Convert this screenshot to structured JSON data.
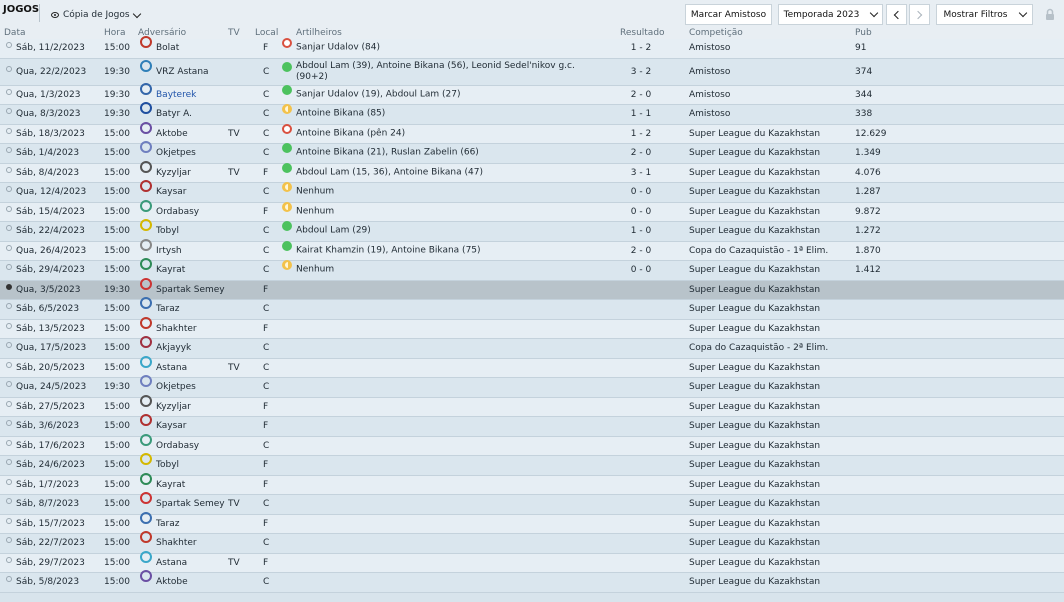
{
  "toolbar": {
    "title": "JOGOS",
    "view_label": "Cópia de Jogos",
    "friendly_button": "Marcar Amistoso",
    "season_select": "Temporada 2023",
    "filters_button": "Mostrar Filtros"
  },
  "columns": {
    "date": "Data",
    "time": "Hora",
    "opponent": "Adversário",
    "tv": "TV",
    "venue": "Local",
    "scorers": "Artilheiros",
    "result": "Resultado",
    "competition": "Competição",
    "attendance": "Pub"
  },
  "colors": {
    "win": "#4cc25e",
    "draw": "#f3c24b",
    "loss": "#d9503f",
    "selected_row": "#b8c3ca"
  },
  "matches": [
    {
      "date": "Sáb, 11/2/2023",
      "time": "15:00",
      "opponent": "Bolat",
      "crest_color": "#c0392b",
      "tv": "",
      "venue": "F",
      "status": "loss",
      "scorers": "Sanjar Udalov (84)",
      "result": "1 - 2",
      "competition": "Amistoso",
      "attendance": "91"
    },
    {
      "date": "Qua, 22/2/2023",
      "time": "19:30",
      "opponent": "VRZ Astana",
      "crest_color": "#2f7fb8",
      "tv": "",
      "venue": "C",
      "status": "win",
      "scorers": "Abdoul Lam (39), Antoine Bikana (56), Leonid Sedel'nikov g.c. (90+2)",
      "result": "3 - 2",
      "competition": "Amistoso",
      "attendance": "374"
    },
    {
      "date": "Qua, 1/3/2023",
      "time": "19:30",
      "opponent": "Bayterek",
      "crest_color": "#3366aa",
      "tv": "",
      "venue": "C",
      "status": "win",
      "scorers": "Sanjar Udalov (19), Abdoul Lam (27)",
      "result": "2 - 0",
      "competition": "Amistoso",
      "attendance": "344"
    },
    {
      "date": "Qua, 8/3/2023",
      "time": "19:30",
      "opponent": "Batyr A.",
      "crest_color": "#1f4fa0",
      "tv": "",
      "venue": "C",
      "status": "draw",
      "scorers": "Antoine Bikana (85)",
      "result": "1 - 1",
      "competition": "Amistoso",
      "attendance": "338"
    },
    {
      "date": "Sáb, 18/3/2023",
      "time": "15:00",
      "opponent": "Aktobe",
      "crest_color": "#6a4fa3",
      "tv": "TV",
      "venue": "C",
      "status": "loss",
      "scorers": "Antoine Bikana (pên 24)",
      "result": "1 - 2",
      "competition": "Super League du Kazakhstan",
      "attendance": "12.629"
    },
    {
      "date": "Sáb, 1/4/2023",
      "time": "15:00",
      "opponent": "Okjetpes",
      "crest_color": "#6f7fbf",
      "tv": "",
      "venue": "C",
      "status": "win",
      "scorers": "Antoine Bikana (21), Ruslan Zabelin (66)",
      "result": "2 - 0",
      "competition": "Super League du Kazakhstan",
      "attendance": "1.349"
    },
    {
      "date": "Sáb, 8/4/2023",
      "time": "15:00",
      "opponent": "Kyzyljar",
      "crest_color": "#555555",
      "tv": "TV",
      "venue": "F",
      "status": "win",
      "scorers": "Abdoul Lam (15, 36), Antoine Bikana (47)",
      "result": "3 - 1",
      "competition": "Super League du Kazakhstan",
      "attendance": "4.076"
    },
    {
      "date": "Qua, 12/4/2023",
      "time": "15:00",
      "opponent": "Kaysar",
      "crest_color": "#b03030",
      "tv": "",
      "venue": "C",
      "status": "draw",
      "scorers": "Nenhum",
      "result": "0 - 0",
      "competition": "Super League du Kazakhstan",
      "attendance": "1.287"
    },
    {
      "date": "Sáb, 15/4/2023",
      "time": "15:00",
      "opponent": "Ordabasy",
      "crest_color": "#3a9a7a",
      "tv": "",
      "venue": "F",
      "status": "draw",
      "scorers": "Nenhum",
      "result": "0 - 0",
      "competition": "Super League du Kazakhstan",
      "attendance": "9.872"
    },
    {
      "date": "Sáb, 22/4/2023",
      "time": "15:00",
      "opponent": "Tobyl",
      "crest_color": "#d4b800",
      "tv": "",
      "venue": "C",
      "status": "win",
      "scorers": "Abdoul Lam (29)",
      "result": "1 - 0",
      "competition": "Super League du Kazakhstan",
      "attendance": "1.272"
    },
    {
      "date": "Qua, 26/4/2023",
      "time": "15:00",
      "opponent": "Irtysh",
      "crest_color": "#888888",
      "tv": "",
      "venue": "C",
      "status": "win",
      "scorers": "Kairat Khamzin (19), Antoine Bikana (75)",
      "result": "2 - 0",
      "competition": "Copa do Cazaquistão - 1ª Elim.",
      "attendance": "1.870"
    },
    {
      "date": "Sáb, 29/4/2023",
      "time": "15:00",
      "opponent": "Kayrat",
      "crest_color": "#2e8b57",
      "tv": "",
      "venue": "C",
      "status": "draw",
      "scorers": "Nenhum",
      "result": "0 - 0",
      "competition": "Super League du Kazakhstan",
      "attendance": "1.412"
    },
    {
      "date": "Qua, 3/5/2023",
      "time": "19:30",
      "opponent": "Spartak Semey",
      "crest_color": "#cc3333",
      "tv": "",
      "venue": "F",
      "status": "",
      "scorers": "",
      "result": "",
      "competition": "Super League du Kazakhstan",
      "attendance": "",
      "selected": true
    },
    {
      "date": "Sáb, 6/5/2023",
      "time": "15:00",
      "opponent": "Taraz",
      "crest_color": "#3c6fb0",
      "tv": "",
      "venue": "C",
      "status": "",
      "scorers": "",
      "result": "",
      "competition": "Super League du Kazakhstan",
      "attendance": ""
    },
    {
      "date": "Sáb, 13/5/2023",
      "time": "15:00",
      "opponent": "Shakhter",
      "crest_color": "#c0392b",
      "tv": "",
      "venue": "F",
      "status": "",
      "scorers": "",
      "result": "",
      "competition": "Super League du Kazakhstan",
      "attendance": ""
    },
    {
      "date": "Qua, 17/5/2023",
      "time": "15:00",
      "opponent": "Akjayyk",
      "crest_color": "#a03040",
      "tv": "",
      "venue": "C",
      "status": "",
      "scorers": "",
      "result": "",
      "competition": "Copa do Cazaquistão - 2ª Elim.",
      "attendance": ""
    },
    {
      "date": "Sáb, 20/5/2023",
      "time": "15:00",
      "opponent": "Astana",
      "crest_color": "#3aa7c9",
      "tv": "TV",
      "venue": "C",
      "status": "",
      "scorers": "",
      "result": "",
      "competition": "Super League du Kazakhstan",
      "attendance": ""
    },
    {
      "date": "Qua, 24/5/2023",
      "time": "19:30",
      "opponent": "Okjetpes",
      "crest_color": "#6f7fbf",
      "tv": "",
      "venue": "C",
      "status": "",
      "scorers": "",
      "result": "",
      "competition": "Super League du Kazakhstan",
      "attendance": ""
    },
    {
      "date": "Sáb, 27/5/2023",
      "time": "15:00",
      "opponent": "Kyzyljar",
      "crest_color": "#555555",
      "tv": "",
      "venue": "F",
      "status": "",
      "scorers": "",
      "result": "",
      "competition": "Super League du Kazakhstan",
      "attendance": ""
    },
    {
      "date": "Sáb, 3/6/2023",
      "time": "15:00",
      "opponent": "Kaysar",
      "crest_color": "#b03030",
      "tv": "",
      "venue": "F",
      "status": "",
      "scorers": "",
      "result": "",
      "competition": "Super League du Kazakhstan",
      "attendance": ""
    },
    {
      "date": "Sáb, 17/6/2023",
      "time": "15:00",
      "opponent": "Ordabasy",
      "crest_color": "#3a9a7a",
      "tv": "",
      "venue": "C",
      "status": "",
      "scorers": "",
      "result": "",
      "competition": "Super League du Kazakhstan",
      "attendance": ""
    },
    {
      "date": "Sáb, 24/6/2023",
      "time": "15:00",
      "opponent": "Tobyl",
      "crest_color": "#d4b800",
      "tv": "",
      "venue": "F",
      "status": "",
      "scorers": "",
      "result": "",
      "competition": "Super League du Kazakhstan",
      "attendance": ""
    },
    {
      "date": "Sáb, 1/7/2023",
      "time": "15:00",
      "opponent": "Kayrat",
      "crest_color": "#2e8b57",
      "tv": "",
      "venue": "F",
      "status": "",
      "scorers": "",
      "result": "",
      "competition": "Super League du Kazakhstan",
      "attendance": ""
    },
    {
      "date": "Sáb, 8/7/2023",
      "time": "15:00",
      "opponent": "Spartak Semey",
      "crest_color": "#cc3333",
      "tv": "TV",
      "venue": "C",
      "status": "",
      "scorers": "",
      "result": "",
      "competition": "Super League du Kazakhstan",
      "attendance": ""
    },
    {
      "date": "Sáb, 15/7/2023",
      "time": "15:00",
      "opponent": "Taraz",
      "crest_color": "#3c6fb0",
      "tv": "",
      "venue": "F",
      "status": "",
      "scorers": "",
      "result": "",
      "competition": "Super League du Kazakhstan",
      "attendance": ""
    },
    {
      "date": "Sáb, 22/7/2023",
      "time": "15:00",
      "opponent": "Shakhter",
      "crest_color": "#c0392b",
      "tv": "",
      "venue": "C",
      "status": "",
      "scorers": "",
      "result": "",
      "competition": "Super League du Kazakhstan",
      "attendance": ""
    },
    {
      "date": "Sáb, 29/7/2023",
      "time": "15:00",
      "opponent": "Astana",
      "crest_color": "#3aa7c9",
      "tv": "TV",
      "venue": "F",
      "status": "",
      "scorers": "",
      "result": "",
      "competition": "Super League du Kazakhstan",
      "attendance": ""
    },
    {
      "date": "Sáb, 5/8/2023",
      "time": "15:00",
      "opponent": "Aktobe",
      "crest_color": "#6a4fa3",
      "tv": "",
      "venue": "C",
      "status": "",
      "scorers": "",
      "result": "",
      "competition": "Super League du Kazakhstan",
      "attendance": ""
    }
  ]
}
